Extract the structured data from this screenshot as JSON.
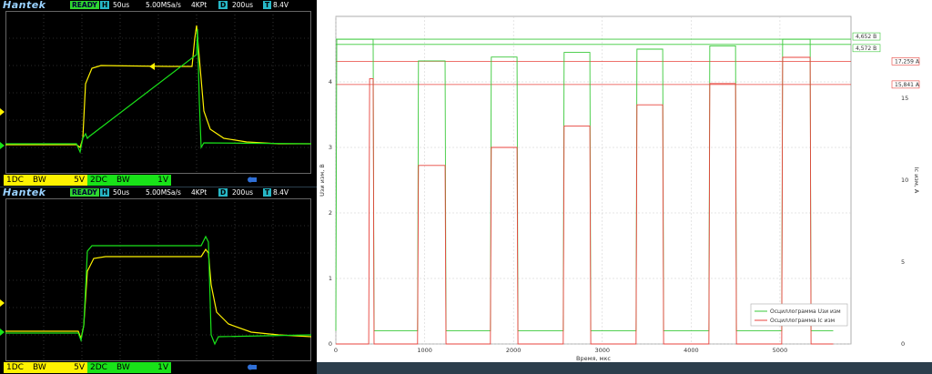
{
  "scope_top": {
    "brand": "Hantek",
    "status": "READY",
    "h_flag": "H",
    "timebase": "50us",
    "sample_rate": "5.00MSa/s",
    "memory": "4KPt",
    "d_flag": "D",
    "delay": "200us",
    "t_flag": "T",
    "trigger_level": "8.4V",
    "ch1_label": "1DC",
    "ch1_bw": "BW",
    "ch1_scale": "5V",
    "ch2_label": "2DC",
    "ch2_bw": "BW",
    "ch2_scale": "1V"
  },
  "scope_bottom": {
    "brand": "Hantek",
    "status": "READY",
    "h_flag": "H",
    "timebase": "50us",
    "sample_rate": "5.00MSa/s",
    "memory": "4KPt",
    "d_flag": "D",
    "delay": "200us",
    "t_flag": "T",
    "trigger_level": "8.4V",
    "ch1_label": "1DC",
    "ch1_bw": "BW",
    "ch1_scale": "5V",
    "ch2_label": "2DC",
    "ch2_bw": "BW",
    "ch2_scale": "1V"
  },
  "colors": {
    "ch1": "#fef200",
    "ch2": "#19e219",
    "graph_green": "#3ac93a",
    "graph_red": "#e8433c",
    "hdr_cyan": "#27b7c6"
  },
  "chart_data": {
    "type": "line",
    "xlabel": "Время, мкс",
    "ylabel_left": "Uзи изм, В",
    "ylabel_right": "Ic изм, А",
    "xlim": [
      0,
      5800
    ],
    "ylim_left": [
      0,
      5
    ],
    "ylim_right": [
      0,
      20
    ],
    "x_ticks": [
      "0",
      "1000",
      "2000",
      "3000",
      "4000",
      "5000"
    ],
    "y_left_ticks": [
      "0",
      "1",
      "2",
      "3",
      "4"
    ],
    "y_right_ticks": [
      "0",
      "5",
      "10",
      "15"
    ],
    "grid": true,
    "legend_position": "bottom-right",
    "series": [
      {
        "name": "Осциллограмма Uзи изм",
        "pulses": [
          [
            0,
            420,
            4.65
          ],
          [
            920,
            1230,
            4.32
          ],
          [
            1740,
            2040,
            4.38
          ],
          [
            2560,
            2860,
            4.45
          ],
          [
            3380,
            3680,
            4.5
          ],
          [
            4200,
            4500,
            4.55
          ],
          [
            5020,
            5340,
            4.65
          ]
        ],
        "baseline": 0.2
      },
      {
        "name": "Осциллограмма Ic изм",
        "pulses": [
          [
            370,
            420,
            16.2
          ],
          [
            920,
            1230,
            10.9
          ],
          [
            1740,
            2040,
            12.0
          ],
          [
            2560,
            2860,
            13.3
          ],
          [
            3380,
            3680,
            14.6
          ],
          [
            4200,
            4500,
            15.9
          ],
          [
            5020,
            5340,
            17.5
          ]
        ],
        "baseline": 0
      }
    ],
    "markers": [
      {
        "label": "4,652 В",
        "axis": "left",
        "value": 4.652,
        "color": "green"
      },
      {
        "label": "4,572 В",
        "axis": "left",
        "value": 4.572,
        "color": "green"
      },
      {
        "label": "17,259 А",
        "axis": "right",
        "value": 17.259,
        "color": "red"
      },
      {
        "label": "15,841 А",
        "axis": "right",
        "value": 15.841,
        "color": "red"
      }
    ]
  }
}
